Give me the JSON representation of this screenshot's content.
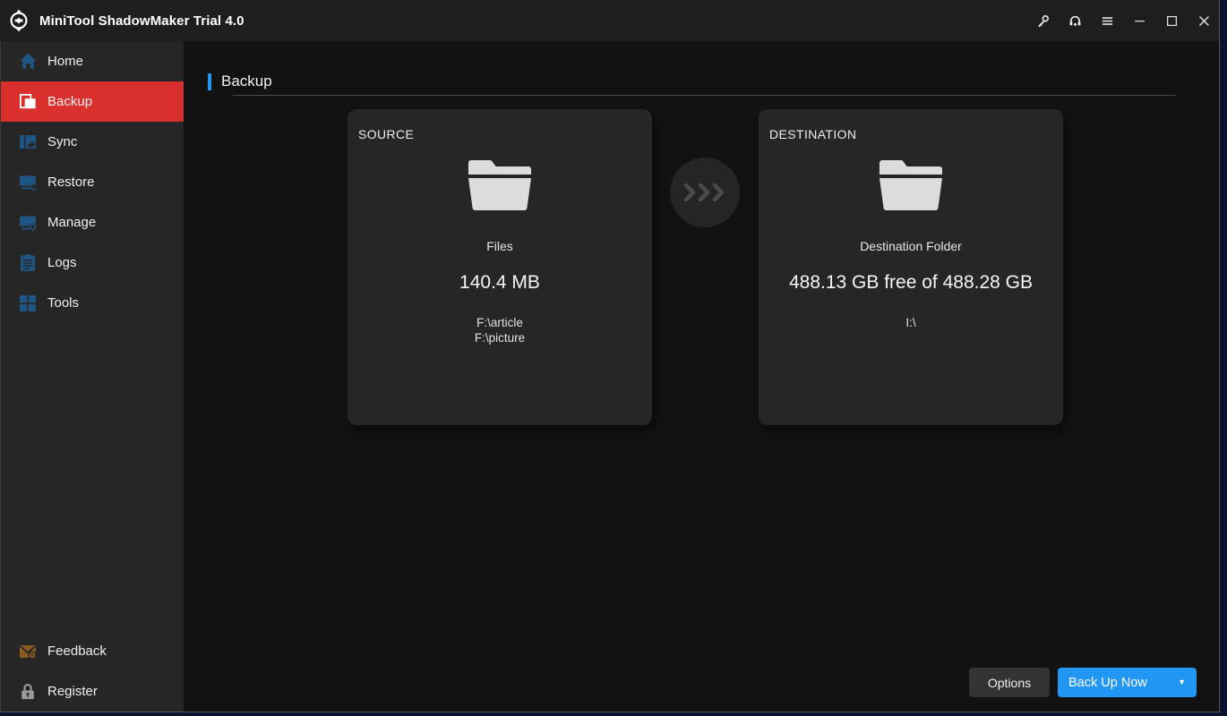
{
  "window": {
    "title": "MiniTool ShadowMaker Trial 4.0",
    "logo_icon": "shadowmaker-logo-icon",
    "controls": [
      {
        "name": "license-key-button",
        "icon": "key-icon"
      },
      {
        "name": "support-button",
        "icon": "headset-icon"
      },
      {
        "name": "menu-button",
        "icon": "hamburger-menu-icon"
      },
      {
        "name": "minimize-button",
        "icon": "minimize-icon"
      },
      {
        "name": "maximize-button",
        "icon": "maximize-icon"
      },
      {
        "name": "close-button",
        "icon": "close-icon"
      }
    ]
  },
  "sidebar": {
    "items": [
      {
        "label": "Home",
        "icon": "home-icon",
        "active": false
      },
      {
        "label": "Backup",
        "icon": "backup-icon",
        "active": true
      },
      {
        "label": "Sync",
        "icon": "sync-icon",
        "active": false
      },
      {
        "label": "Restore",
        "icon": "restore-icon",
        "active": false
      },
      {
        "label": "Manage",
        "icon": "manage-icon",
        "active": false
      },
      {
        "label": "Logs",
        "icon": "logs-icon",
        "active": false
      },
      {
        "label": "Tools",
        "icon": "tools-icon",
        "active": false
      }
    ],
    "bottom_items": [
      {
        "label": "Feedback",
        "icon": "feedback-envelope-icon"
      },
      {
        "label": "Register",
        "icon": "lock-icon"
      }
    ]
  },
  "page": {
    "title": "Backup",
    "accent_color": "#2196f3"
  },
  "source": {
    "label": "SOURCE",
    "icon": "folder-icon",
    "type": "Files",
    "size": "140.4 MB",
    "paths": [
      "F:\\article",
      "F:\\picture"
    ]
  },
  "transfer": {
    "icon": "chevrons-right-icon"
  },
  "destination": {
    "label": "DESTINATION",
    "icon": "folder-icon",
    "type": "Destination Folder",
    "capacity": "488.13 GB free of 488.28 GB",
    "path": "I:\\"
  },
  "footer": {
    "options_label": "Options",
    "backup_label": "Back Up Now",
    "backup_caret": "▼",
    "backup_color": "#2196f3"
  },
  "colors": {
    "sidebar_bg": "#262626",
    "content_bg": "#121212",
    "titlebar_bg": "#1e1e1e",
    "active_red": "#d9302e",
    "icon_blue": "#1f5582",
    "folder_gray": "#dcdcdc"
  }
}
